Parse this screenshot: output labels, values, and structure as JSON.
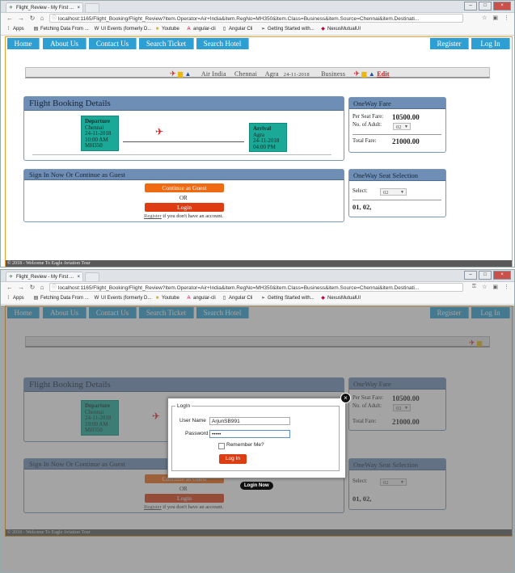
{
  "browser": {
    "tab_title": "Flight_Review - My First ...",
    "tab_close": "×",
    "url": "localhost:1165/Flight_Booking/Flight_Review?item.Operator=Air+India&item.RegNo=MH350&item.Class=Business&item.Source=Chennai&item.Destinati...",
    "bookmarks": [
      "Apps",
      "Fetching Data From ...",
      "UI Events (formerly D...",
      "Youtube",
      "angular-cli",
      "Angular Cli",
      "Getting Started with...",
      "NexusMutualUI"
    ]
  },
  "nav": {
    "home": "Home",
    "about": "About Us",
    "contact": "Contact Us",
    "search_ticket": "Search Ticket",
    "search_hotel": "Search Hotel",
    "register": "Register",
    "login": "Log In"
  },
  "summary": {
    "operator": "Air India",
    "source": "Chennai",
    "destination": "Agra",
    "date": "24-11-2018",
    "class": "Business",
    "edit": "Edit"
  },
  "booking": {
    "title": "Flight Booking Details",
    "departure": {
      "label": "Departure",
      "city": "Chennai",
      "date": "24-11-2018",
      "time": "10:00 AM",
      "regno": "MH350"
    },
    "arrival": {
      "label": "Arrival",
      "city": "Agra",
      "date": "24-11-2018",
      "time": "04:00 PM"
    }
  },
  "fare": {
    "title": "OneWay Fare",
    "per_seat_label": "Per Seat Fare:",
    "per_seat_value": "10500.00",
    "adult_label": "No. of Adult:",
    "adult_value": "02",
    "total_label": "Total Fare:",
    "total_value": "21000.00"
  },
  "signin": {
    "title": "Sign In Now Or Continue as Guest",
    "guest_btn": "Continue as Guest",
    "or": "OR",
    "login_btn": "Login",
    "register_link": "Register",
    "register_text": "if you don't have an account."
  },
  "seats": {
    "title": "OneWay Seat Selection",
    "select_label": "Select:",
    "select_value": "02",
    "selected": "01, 02,"
  },
  "footer": "© 2018 - Welcome To Eagle Aviation Tour",
  "login_modal": {
    "legend": "LogIn",
    "username_label": "User Name",
    "username_value": "ArjunSB991",
    "password_label": "Password",
    "password_value": "•••••",
    "remember_label": "Remember Me?",
    "submit": "Log In",
    "close": "×",
    "tooltip": "Login Now"
  }
}
